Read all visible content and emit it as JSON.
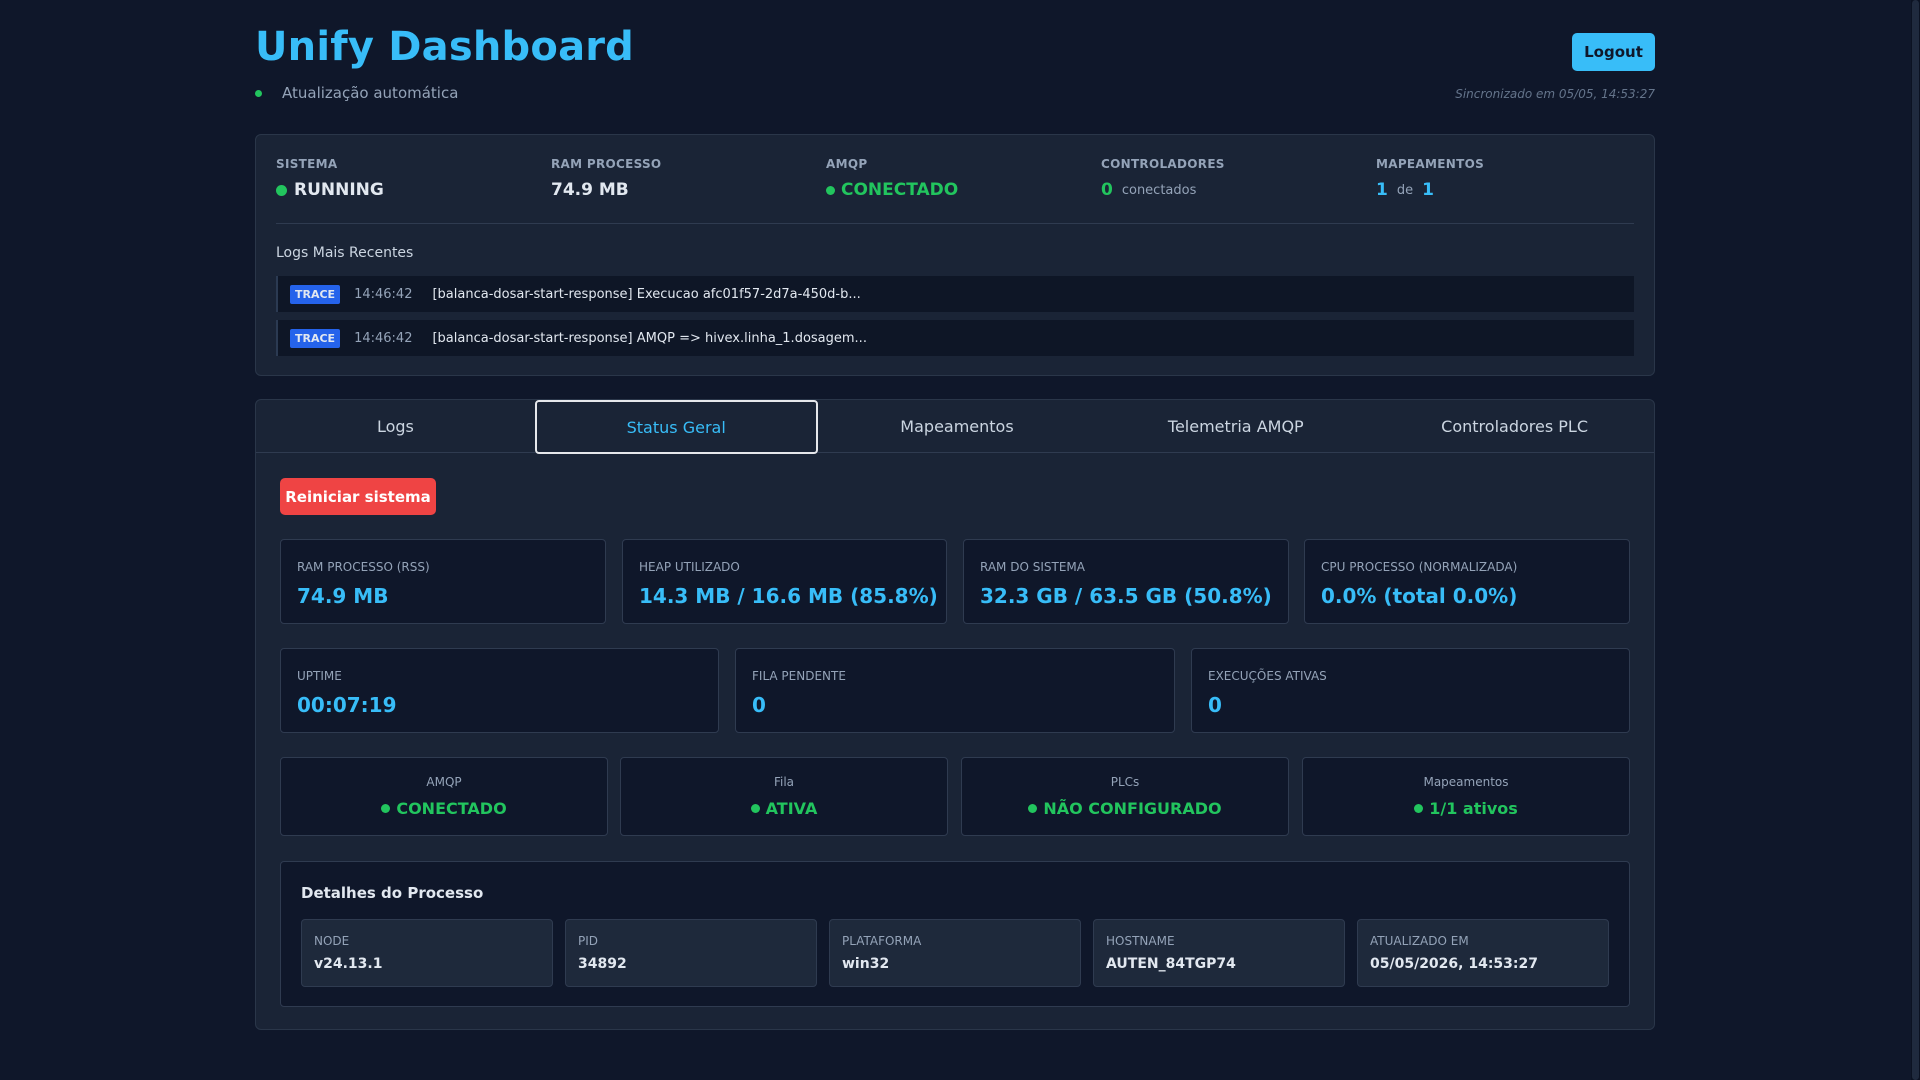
{
  "header": {
    "title": "Unify Dashboard",
    "auto_refresh": "Atualização automática",
    "logout_label": "Logout",
    "sync_text": "Sincronizado em 05/05, 14:53:27"
  },
  "summary": {
    "sistema": {
      "label": "SISTEMA",
      "value": "RUNNING"
    },
    "ram": {
      "label": "RAM PROCESSO",
      "value": "74.9 MB"
    },
    "amqp": {
      "label": "AMQP",
      "value": "CONECTADO"
    },
    "controladores": {
      "label": "CONTROLADORES",
      "count": "0",
      "suffix": "conectados"
    },
    "mapeamentos": {
      "label": "MAPEAMENTOS",
      "active": "1",
      "sep": "de",
      "total": "1"
    },
    "logs_title": "Logs Mais Recentes",
    "logs": [
      {
        "level": "TRACE",
        "time": "14:46:42",
        "message": "[balanca-dosar-start-response] Execucao afc01f57-2d7a-450d-b..."
      },
      {
        "level": "TRACE",
        "time": "14:46:42",
        "message": "[balanca-dosar-start-response] AMQP => hivex.linha_1.dosagem..."
      }
    ]
  },
  "tabs": [
    "Logs",
    "Status Geral",
    "Mapeamentos",
    "Telemetria AMQP",
    "Controladores PLC"
  ],
  "active_tab": "Status Geral",
  "restart_label": "Reiniciar sistema",
  "metrics_row1": [
    {
      "label": "RAM PROCESSO (RSS)",
      "value": "74.9 MB"
    },
    {
      "label": "HEAP UTILIZADO",
      "value": "14.3 MB / 16.6 MB (85.8%)"
    },
    {
      "label": "RAM DO SISTEMA",
      "value": "32.3 GB / 63.5 GB (50.8%)"
    },
    {
      "label": "CPU PROCESSO (NORMALIZADA)",
      "value": "0.0% (total 0.0%)"
    }
  ],
  "metrics_row2": [
    {
      "label": "UPTIME",
      "value": "00:07:19"
    },
    {
      "label": "FILA PENDENTE",
      "value": "0"
    },
    {
      "label": "EXECUÇÕES ATIVAS",
      "value": "0"
    }
  ],
  "status_row": [
    {
      "label": "AMQP",
      "value": "CONECTADO"
    },
    {
      "label": "Fila",
      "value": "ATIVA"
    },
    {
      "label": "PLCs",
      "value": "NÃO CONFIGURADO"
    },
    {
      "label": "Mapeamentos",
      "value": "1/1 ativos"
    }
  ],
  "details": {
    "title": "Detalhes do Processo",
    "items": [
      {
        "label": "NODE",
        "value": "v24.13.1"
      },
      {
        "label": "PID",
        "value": "34892"
      },
      {
        "label": "PLATAFORMA",
        "value": "win32"
      },
      {
        "label": "HOSTNAME",
        "value": "AUTEN_84TGP74"
      },
      {
        "label": "ATUALIZADO EM",
        "value": "05/05/2026, 14:53:27"
      }
    ]
  },
  "colors": {
    "accent": "#38bdf8",
    "success": "#22c55e",
    "danger": "#ef4444",
    "background": "#0f172a",
    "panel": "#1a2436"
  }
}
